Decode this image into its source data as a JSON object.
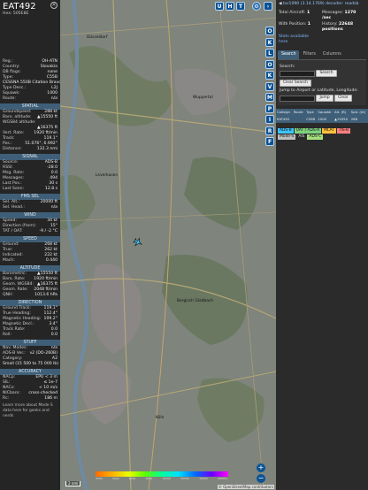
{
  "aircraft": {
    "callsign": "EAT492",
    "hex_line": "Hex: 505E8E",
    "close_label": "✕",
    "details": [
      {
        "k": "Reg.:",
        "v": "OH-ATN"
      },
      {
        "k": "Country:",
        "v": "Slovakia"
      },
      {
        "k": "DB flags:",
        "v": "none"
      },
      {
        "k": "Type:",
        "v": "C55B"
      },
      {
        "k": "",
        "v": "CESSNA 550B Citation Bravo"
      },
      {
        "k": "Type Desc.:",
        "v": "L2J"
      },
      {
        "k": "Squawk:",
        "v": "1000"
      },
      {
        "k": "Route:",
        "v": "n/a"
      }
    ]
  },
  "sections": {
    "spatial": {
      "title": "SPATIAL",
      "rows": [
        {
          "k": "Groundspeed:",
          "v": "288 kt"
        },
        {
          "k": "Baro. altitude:",
          "v": "▲15550 ft"
        },
        {
          "k": "WGS84 altitude:",
          "v": ""
        },
        {
          "k": "",
          "v": "▲16375 ft"
        },
        {
          "k": "Vert. Rate:",
          "v": "1920 ft/min"
        },
        {
          "k": "Track:",
          "v": "119.1°"
        },
        {
          "k": "Pos.:",
          "v": "51.076°, 6.992°"
        },
        {
          "k": "Distance:",
          "v": "132.3 nmi"
        }
      ]
    },
    "signal": {
      "title": "SIGNAL",
      "rows": [
        {
          "k": "Source:",
          "v": "ADS-B"
        },
        {
          "k": "RSSI:",
          "v": "-28.0"
        },
        {
          "k": "Msg. Rate:",
          "v": "0.0"
        },
        {
          "k": "Messages:",
          "v": "494"
        },
        {
          "k": "Last Pos.:",
          "v": "30 s"
        },
        {
          "k": "Last Seen:",
          "v": "12.8 s"
        }
      ]
    },
    "fms": {
      "title": "FMS SEL",
      "rows": [
        {
          "k": "Sel. Alt.:",
          "v": "20000 ft"
        },
        {
          "k": "Sel. Head.:",
          "v": "n/a"
        }
      ]
    },
    "wind": {
      "title": "WIND",
      "rows": [
        {
          "k": "Speed:",
          "v": "34 kt"
        },
        {
          "k": "Direction (from):",
          "v": "15°"
        },
        {
          "k": "TAT / OAT:",
          "v": "-9 / -2 °C"
        }
      ]
    },
    "speed": {
      "title": "SPEED",
      "rows": [
        {
          "k": "Ground:",
          "v": "268 kt"
        },
        {
          "k": "True:",
          "v": "262 kt"
        },
        {
          "k": "Indicated:",
          "v": "222 kt"
        },
        {
          "k": "Mach:",
          "v": "0.440"
        }
      ]
    },
    "altitude": {
      "title": "ALTITUDE",
      "rows": [
        {
          "k": "Barometric:",
          "v": "▲15550 ft"
        },
        {
          "k": "Baro. Rate:",
          "v": "1920 ft/min"
        },
        {
          "k": "Geom. WGS84:",
          "v": "▲16375 ft"
        },
        {
          "k": "Geom. Rate:",
          "v": "2048 ft/min"
        },
        {
          "k": "QNH:",
          "v": "1013.6 hPa"
        }
      ]
    },
    "direction": {
      "title": "DIRECTION",
      "rows": [
        {
          "k": "Ground Track:",
          "v": "119.1°"
        },
        {
          "k": "True Heading:",
          "v": "112.4°"
        },
        {
          "k": "Magnetic Heading:",
          "v": "109.2°"
        },
        {
          "k": "Magnetic Decl.:",
          "v": "3.4°"
        },
        {
          "k": "Track Rate:",
          "v": "0.0"
        },
        {
          "k": "Roll:",
          "v": "0.0"
        }
      ]
    },
    "stuff": {
      "title": "STUFF",
      "rows": [
        {
          "k": "Nav. Modes:",
          "v": "n/a"
        },
        {
          "k": "ADS-B Ver.:",
          "v": "v2 (DO-260B)"
        },
        {
          "k": "Category:",
          "v": "A2"
        },
        {
          "k": "",
          "v": "Small (15 500 to 75 000 lb)"
        }
      ]
    },
    "accuracy": {
      "title": "ACCURACY",
      "rows": [
        {
          "k": "NACp:",
          "v": "EPU < 3 m"
        },
        {
          "k": "SIL:",
          "v": "≤ 1e-7"
        },
        {
          "k": "NACv:",
          "v": "< 10 m/s"
        },
        {
          "k": "NICbaro:",
          "v": "cross-checked"
        },
        {
          "k": "Rc:",
          "v": "186 m"
        }
      ]
    },
    "bottom_note": "Learn more about Mode S data here for geeks and nerds"
  },
  "map": {
    "top_buttons": [
      "U",
      "H",
      "T"
    ],
    "side_buttons": [
      "O",
      "K",
      "L",
      "O",
      "K",
      "V",
      "M",
      "P",
      "I",
      "R",
      "F"
    ],
    "zoom_in": "+",
    "zoom_out": "−",
    "scale_label": "2 nmi",
    "colorbar_ticks": [
      "2000",
      "4000",
      "6000",
      "8000",
      "10000",
      "20000",
      "30000",
      "40000+"
    ],
    "attribution": "© OpenStreetMap contributors",
    "place_labels": [
      "Wuppertal",
      "Bergisch Gladbach",
      "Köln",
      "Leverkusen",
      "Düsseldorf"
    ]
  },
  "right": {
    "toplink_prefix": "◀",
    "toplink_text": "tar1090 (3.14.1769) decoder: readsb",
    "stats": [
      {
        "k": "Total Aircraft:",
        "v": "1"
      },
      {
        "k": "Messages:",
        "v": "1270 /sec"
      },
      {
        "k": "With Position:",
        "v": "1"
      },
      {
        "k": "History:",
        "v": "22648 positions"
      }
    ],
    "stats_link": "Stats available",
    "stats_link2": "here",
    "tabs": [
      "Search",
      "Filters",
      "Columns"
    ],
    "search_label": "Search:",
    "search_button": "Search",
    "clear_search_button": "Clear Search",
    "jump_label": "Jump to Airport or Latitude, Longitude:",
    "jump_button": "Jump",
    "clear_button": "Clear",
    "table_headers": [
      "Callsign",
      "Route",
      "Type",
      "Squawk",
      "Alt. (ft)",
      "Spd. (kt)"
    ],
    "table_rows": [
      [
        "EAT492",
        "",
        "C55B",
        "1000",
        "▲15550",
        "268"
      ]
    ],
    "legend": [
      {
        "label": "ADS-B",
        "color": "#3fc3ff"
      },
      {
        "label": "UAT / ADS-R",
        "color": "#7fd37f"
      },
      {
        "label": "MLAT",
        "color": "#ffc03f"
      },
      {
        "label": "TIS-B",
        "color": "#ff7f7f"
      },
      {
        "label": "Mode-S",
        "color": "#bdbdbd"
      },
      {
        "label": "AIS",
        "color": "#2b2b2b"
      },
      {
        "label": "ADS-C",
        "color": "#a6e07f"
      }
    ]
  }
}
